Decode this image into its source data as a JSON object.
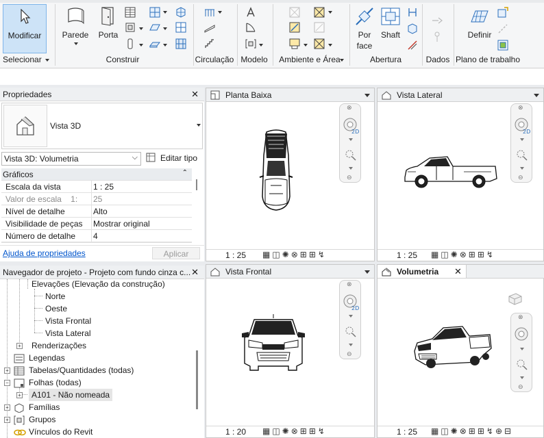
{
  "ribbon": {
    "modify_label": "Modificar",
    "select_label": "Selecionar",
    "buttons": {
      "wall": "Parede",
      "door": "Porta",
      "by_face": "Por\nface",
      "by_face_1": "Por",
      "by_face_2": "face",
      "shaft": "Shaft",
      "define": "Definir"
    },
    "panels": {
      "build": "Construir",
      "circulation": "Circulação",
      "model": "Modelo",
      "room_area": "Ambiente e Área",
      "opening": "Abertura",
      "datum": "Dados",
      "work_plane": "Plano de trabalho"
    }
  },
  "properties": {
    "title": "Propriedades",
    "type_name": "Vista 3D",
    "instance_combo": "Vista 3D: Volumetria",
    "edit_type": "Editar tipo",
    "group": "Gráficos",
    "rows": [
      {
        "name": "Escala da vista",
        "value": "1 : 25"
      },
      {
        "name": "Valor de escala    1:",
        "value": "25"
      },
      {
        "name": "Nível de detalhe",
        "value": "Alto"
      },
      {
        "name": "Visibilidade de peças",
        "value": "Mostrar original"
      },
      {
        "name": "Número de detalhe",
        "value": "4"
      }
    ],
    "help_link": "Ajuda de propriedades",
    "apply": "Aplicar"
  },
  "navigator": {
    "title": "Navegador de projeto - Projeto com fundo cinza c...",
    "items": [
      "Elevações (Elevação da construção)",
      "Norte",
      "Oeste",
      "Vista Frontal",
      "Vista Lateral",
      "Renderizações",
      "Legendas",
      "Tabelas/Quantidades (todas)",
      "Folhas (todas)",
      "A101 - Não nomeada",
      "Famílias",
      "Grupos",
      "Vínculos do Revit"
    ]
  },
  "views": {
    "plan": {
      "title": "Planta Baixa",
      "scale": "1 : 25"
    },
    "side": {
      "title": "Vista Lateral",
      "scale": "1 : 25"
    },
    "front": {
      "title": "Vista Frontal",
      "scale": "1 : 20"
    },
    "volumetric": {
      "title": "Volumetria",
      "scale": "1 : 25"
    }
  },
  "colors": {
    "accent": "#cde3f7",
    "tab_bg": "#eef0f2",
    "link": "#0055cc"
  }
}
